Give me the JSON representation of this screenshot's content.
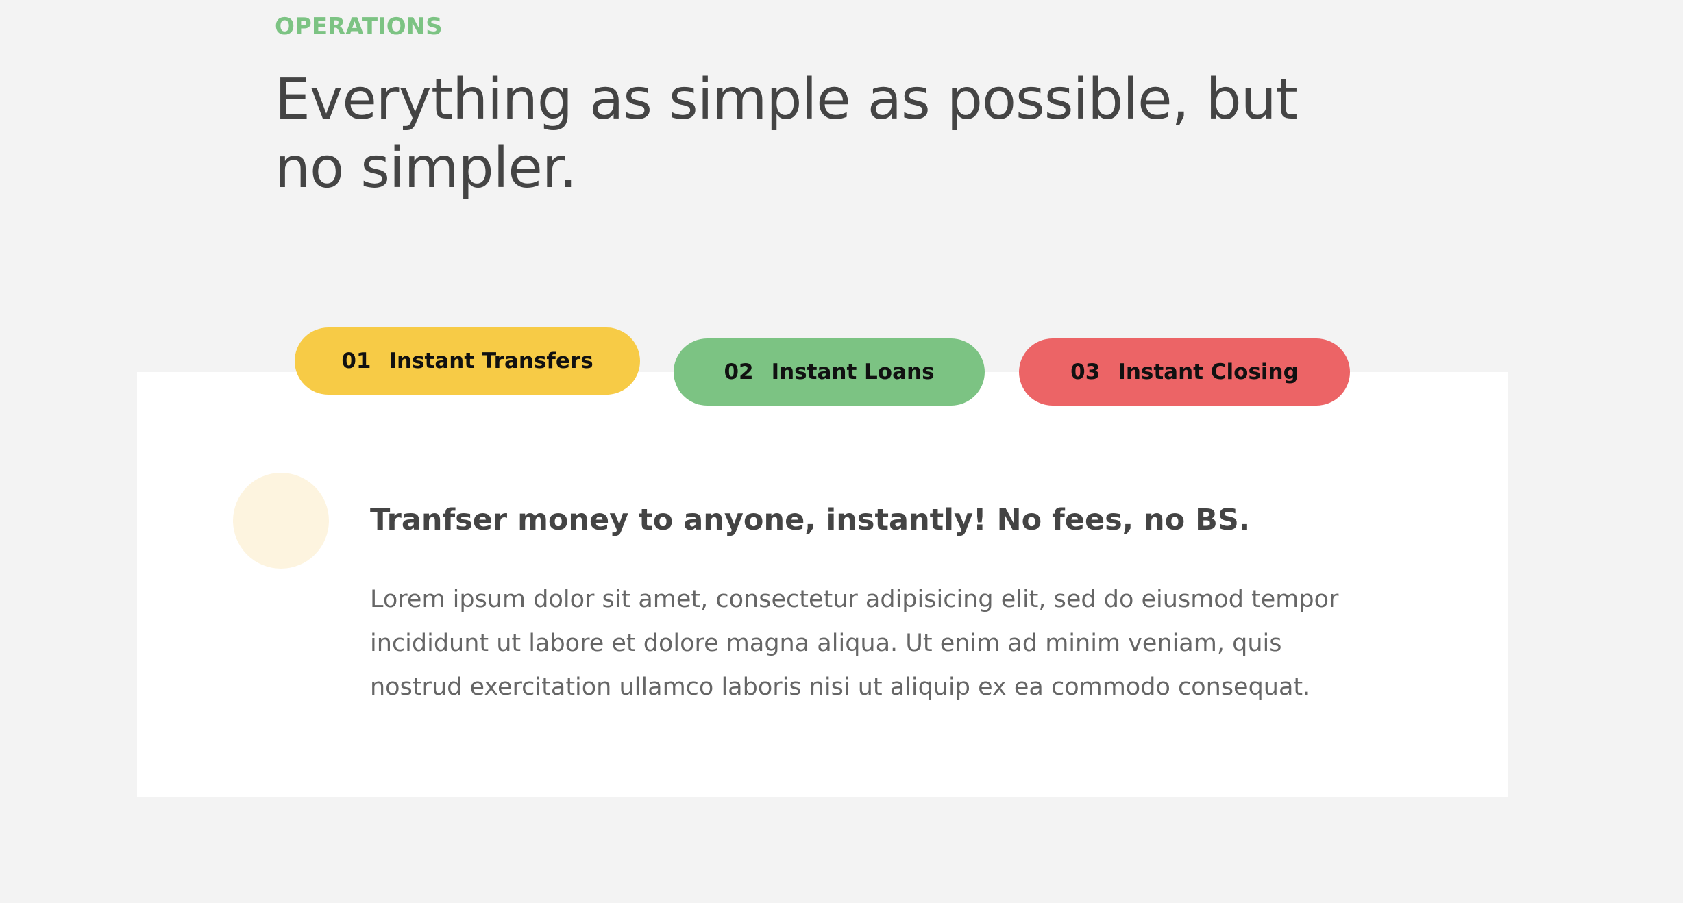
{
  "section": {
    "eyebrow": "OPERATIONS",
    "title": "Everything as simple as possible, but no simpler."
  },
  "tabs": [
    {
      "number": "01",
      "label": "Instant Transfers",
      "color": "#f7cb46",
      "active": true
    },
    {
      "number": "02",
      "label": "Instant Loans",
      "color": "#7cc383",
      "active": false
    },
    {
      "number": "03",
      "label": "Instant Closing",
      "color": "#ec6466",
      "active": false
    }
  ],
  "content": {
    "icon": "transfer-icon",
    "heading": "Tranfser money to anyone, instantly! No fees, no BS.",
    "body": "Lorem ipsum dolor sit amet, consectetur adipisicing elit, sed do eiusmod tempor incididunt ut labore et dolore magna aliqua. Ut enim ad minim veniam, quis nostrud exercitation ullamco laboris nisi ut aliquip ex ea commodo consequat."
  },
  "colors": {
    "accent_green": "#7cc383",
    "background": "#f3f3f3",
    "panel": "#ffffff",
    "text_dark": "#444444",
    "text_muted": "#666666",
    "icon_background": "#fdf4df"
  }
}
